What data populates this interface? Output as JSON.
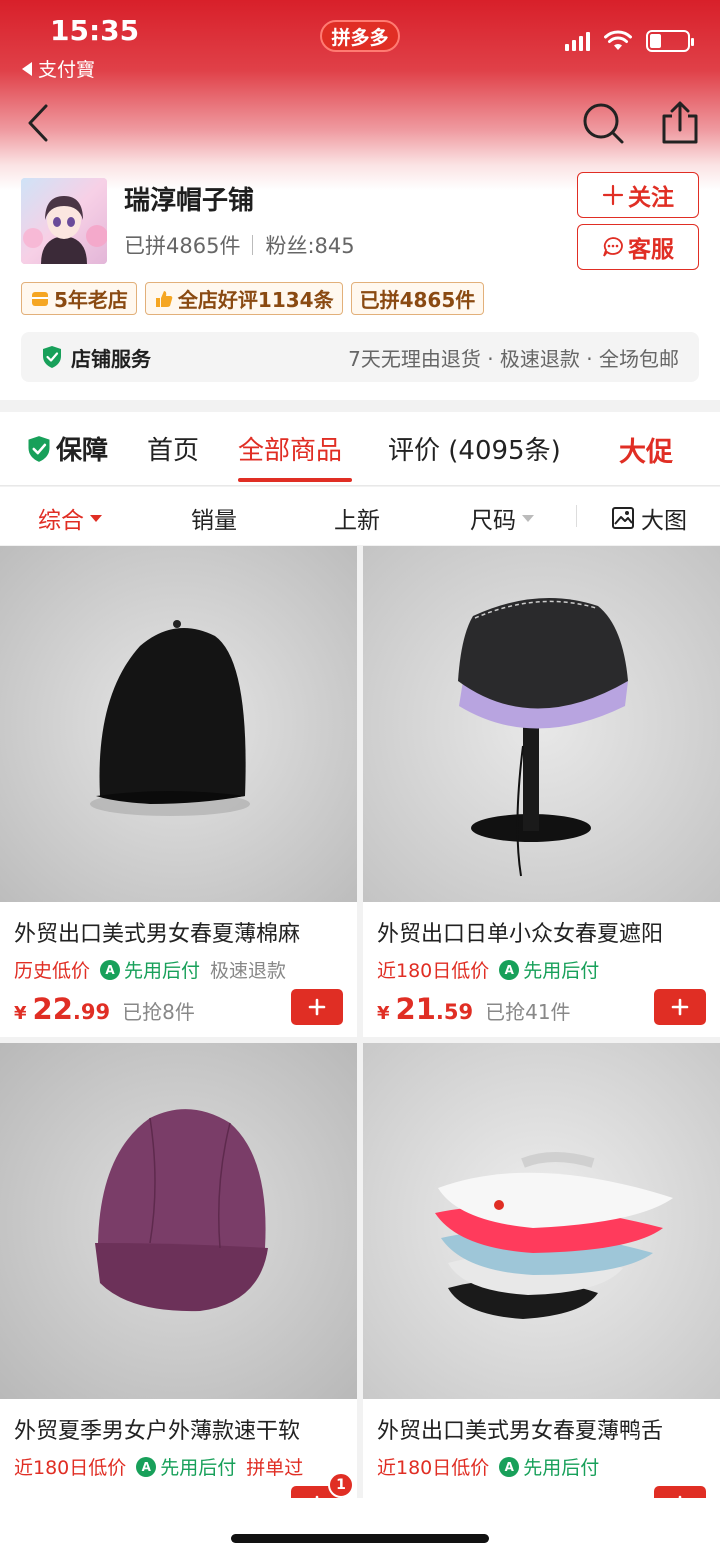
{
  "status": {
    "time": "15:35",
    "back_app": "支付寶",
    "app_pill": "拼多多"
  },
  "shop": {
    "name": "瑞淳帽子铺",
    "sold": "已拼4865件",
    "fans": "粉丝:845",
    "follow_label": "关注",
    "service_label": "客服",
    "badges": [
      "5年老店",
      "全店好评1134条",
      "已拼4865件"
    ],
    "service_title": "店铺服务",
    "service_desc": "7天无理由退货 · 极速退款 · 全场包邮"
  },
  "tabs": [
    "保障",
    "首页",
    "全部商品",
    "评价 (4095条)",
    "大促"
  ],
  "active_tab": "全部商品",
  "sort": {
    "items": [
      "综合",
      "销量",
      "上新",
      "尺码",
      "大图"
    ],
    "active": "综合"
  },
  "products": [
    {
      "title": "外贸出口美式男女春夏薄棉麻",
      "tags": [
        "历史低价",
        "先用后付",
        "极速退款"
      ],
      "price_symbol": "¥",
      "price_int": "22",
      "price_dec": ".99",
      "sold": "已抢8件"
    },
    {
      "title": "外贸出口日单小众女春夏遮阳",
      "tags": [
        "近180日低价",
        "先用后付"
      ],
      "price_symbol": "¥",
      "price_int": "21",
      "price_dec": ".59",
      "sold": "已抢41件"
    },
    {
      "title": "外贸夏季男女户外薄款速干软",
      "tags": [
        "近180日低价",
        "先用后付",
        "拼单过"
      ]
    },
    {
      "title": "外贸出口美式男女春夏薄鸭舌",
      "tags": [
        "近180日低价",
        "先用后付"
      ]
    }
  ],
  "cart_count": "1",
  "colors": {
    "accent": "#e02e24",
    "green": "#18a05a",
    "badge_border": "#e2b07a"
  }
}
